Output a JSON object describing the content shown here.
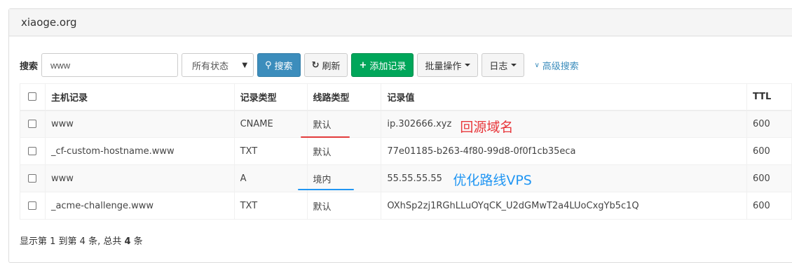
{
  "panel": {
    "title": "xiaoge.org"
  },
  "toolbar": {
    "search_label": "搜索",
    "search_value": "www",
    "status_select": "所有状态",
    "search_button": "搜索",
    "refresh_button": "刷新",
    "add_button": "添加记录",
    "batch_button": "批量操作",
    "log_button": "日志",
    "advanced_search": "高级搜索"
  },
  "table": {
    "headers": [
      "主机记录",
      "记录类型",
      "线路类型",
      "记录值",
      "TTL"
    ],
    "rows": [
      {
        "host": "www",
        "type": "CNAME",
        "route": "默认",
        "value": "ip.302666.xyz",
        "ttl": "600"
      },
      {
        "host": "_cf-custom-hostname.www",
        "type": "TXT",
        "route": "默认",
        "value": "77e01185-b263-4f80-99d8-0f0f1cb35eca",
        "ttl": "600"
      },
      {
        "host": "www",
        "type": "A",
        "route": "境内",
        "value": "55.55.55.55",
        "ttl": "600"
      },
      {
        "host": "_acme-challenge.www",
        "type": "TXT",
        "route": "默认",
        "value": "OXhSp2zj1RGhLLuOYqCK_U2dGMwT2a4LUoCxgYb5c1Q",
        "ttl": "600"
      }
    ]
  },
  "annotations": {
    "row1": "回源域名",
    "row3": "优化路线VPS"
  },
  "summary": {
    "prefix": "显示第 1 到第 4 条, 总共 ",
    "total": "4",
    "suffix": " 条"
  },
  "colors": {
    "primary": "#3c8dbc",
    "success": "#00a65a",
    "annotation_red": "#e8363a",
    "annotation_blue": "#2196f3"
  }
}
